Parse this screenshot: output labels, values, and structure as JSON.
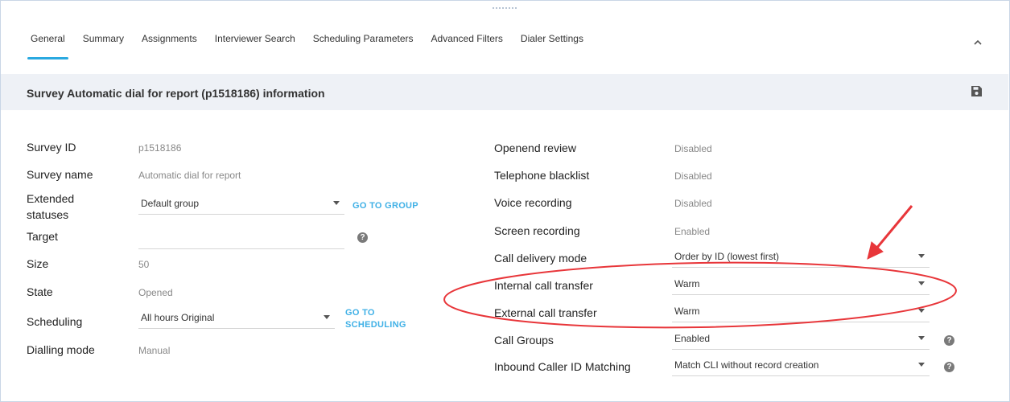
{
  "tabs": [
    "General",
    "Summary",
    "Assignments",
    "Interviewer Search",
    "Scheduling Parameters",
    "Advanced Filters",
    "Dialer Settings"
  ],
  "section": {
    "title": "Survey Automatic dial for report (p1518186) information"
  },
  "left": {
    "survey_id": {
      "label": "Survey ID",
      "value": "p1518186"
    },
    "survey_name": {
      "label": "Survey name",
      "value": "Automatic dial for report"
    },
    "extended_statuses": {
      "label_line1": "Extended",
      "label_line2": "statuses",
      "value": "Default group",
      "link": "GO TO GROUP"
    },
    "target": {
      "label": "Target",
      "value": ""
    },
    "size": {
      "label": "Size",
      "value": "50"
    },
    "state": {
      "label": "State",
      "value": "Opened"
    },
    "scheduling": {
      "label": "Scheduling",
      "value": "All hours Original",
      "link_line1": "GO TO",
      "link_line2": "SCHEDULING"
    },
    "dialling_mode": {
      "label": "Dialling mode",
      "value": "Manual"
    }
  },
  "right": {
    "openend_review": {
      "label": "Openend review",
      "value": "Disabled"
    },
    "telephone_blacklist": {
      "label": "Telephone blacklist",
      "value": "Disabled"
    },
    "voice_recording": {
      "label": "Voice recording",
      "value": "Disabled"
    },
    "screen_recording": {
      "label": "Screen recording",
      "value": "Enabled"
    },
    "call_delivery_mode": {
      "label": "Call delivery mode",
      "value": "Order by ID (lowest first)"
    },
    "internal_call_transfer": {
      "label": "Internal call transfer",
      "value": "Warm"
    },
    "external_call_transfer": {
      "label": "External call transfer",
      "value": "Warm"
    },
    "call_groups": {
      "label": "Call Groups",
      "value": "Enabled"
    },
    "inbound_caller_id": {
      "label": "Inbound Caller ID Matching",
      "value": "Match CLI without record creation"
    }
  },
  "icons": {
    "collapse": "chevron-up-icon",
    "save": "save-icon",
    "help": "help-icon"
  },
  "colors": {
    "accent": "#2aa9e0",
    "link": "#3fb0e6",
    "annotation": "#e8363a"
  }
}
